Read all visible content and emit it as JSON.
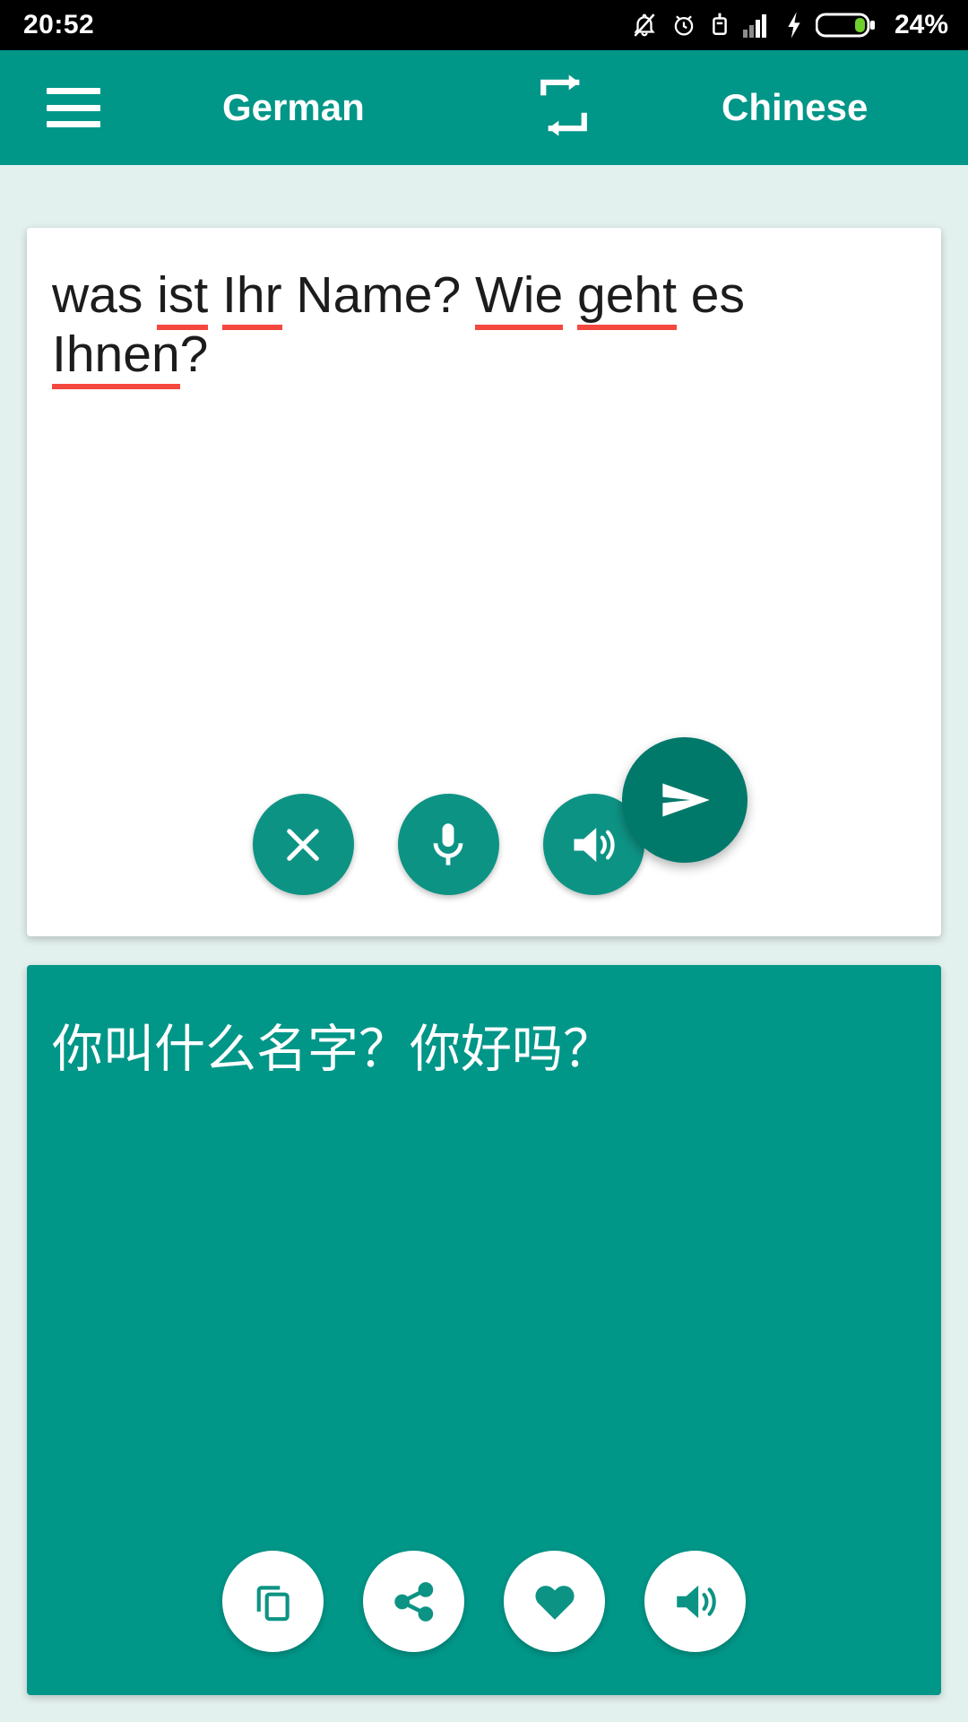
{
  "statusbar": {
    "time": "20:52",
    "battery_percent": "24%",
    "icons": [
      "notifications-off-icon",
      "alarm-icon",
      "usb-icon",
      "signal-icon",
      "charging-bolt-icon",
      "battery-icon"
    ]
  },
  "appbar": {
    "menu_icon": "hamburger-menu-icon",
    "source_language": "German",
    "swap_icon": "swap-languages-icon",
    "target_language": "Chinese"
  },
  "source": {
    "text": "was ist Ihr Name? Wie geht es Ihnen?",
    "tokens": [
      {
        "t": "was ",
        "misspelled": false
      },
      {
        "t": "ist",
        "misspelled": true
      },
      {
        "t": " ",
        "misspelled": false
      },
      {
        "t": "Ihr",
        "misspelled": true
      },
      {
        "t": " Name? ",
        "misspelled": false
      },
      {
        "t": "Wie",
        "misspelled": true
      },
      {
        "t": " ",
        "misspelled": false
      },
      {
        "t": "geht",
        "misspelled": true
      },
      {
        "t": " es ",
        "misspelled": false
      },
      {
        "t": "Ihnen",
        "misspelled": true
      },
      {
        "t": "?",
        "misspelled": false
      }
    ],
    "actions": [
      {
        "name": "clear-button",
        "icon": "close-icon"
      },
      {
        "name": "microphone-button",
        "icon": "microphone-icon"
      },
      {
        "name": "speak-source-button",
        "icon": "speaker-icon"
      }
    ]
  },
  "send": {
    "icon": "send-icon"
  },
  "target": {
    "text": "你叫什么名字？你好吗？",
    "actions": [
      {
        "name": "copy-button",
        "icon": "copy-icon"
      },
      {
        "name": "share-button",
        "icon": "share-icon"
      },
      {
        "name": "favorite-button",
        "icon": "heart-icon"
      },
      {
        "name": "speak-target-button",
        "icon": "speaker-icon"
      }
    ]
  },
  "colors": {
    "primary_teal": "#009688",
    "dark_teal": "#00796b",
    "button_teal": "#0d9384",
    "background": "#e2f0ee",
    "statusbar": "#000000",
    "misspelled_underline": "#f4483f",
    "battery_green": "#6fcf2b"
  }
}
